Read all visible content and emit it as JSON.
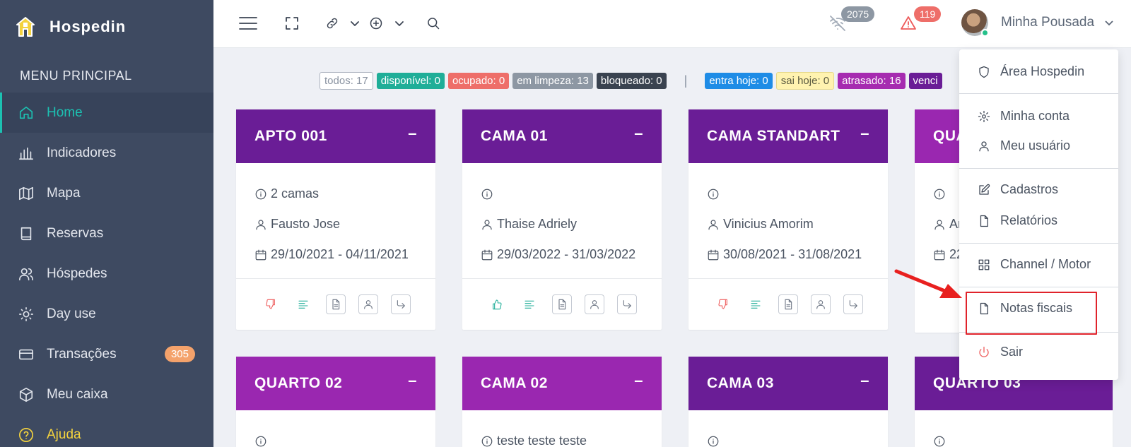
{
  "brand": {
    "name": "Hospedin"
  },
  "sidebar": {
    "title": "MENU PRINCIPAL",
    "items": [
      {
        "label": "Home",
        "icon": "home-icon",
        "active": true
      },
      {
        "label": "Indicadores",
        "icon": "bar-chart-icon"
      },
      {
        "label": "Mapa",
        "icon": "map-icon"
      },
      {
        "label": "Reservas",
        "icon": "book-icon"
      },
      {
        "label": "Hóspedes",
        "icon": "users-icon"
      },
      {
        "label": "Day use",
        "icon": "sun-icon"
      },
      {
        "label": "Transações",
        "icon": "credit-card-icon",
        "count": "305"
      },
      {
        "label": "Meu caixa",
        "icon": "box-icon"
      },
      {
        "label": "Ajuda",
        "icon": "help-circle-icon"
      }
    ]
  },
  "topbar": {
    "wifi_badge": "2075",
    "alert_badge": "119",
    "user_name": "Minha Pousada"
  },
  "status": {
    "todos": "todos: 17",
    "disponivel": "disponível: 0",
    "ocupado": "ocupado: 0",
    "limpeza": "em limpeza: 13",
    "bloqueado": "bloqueado: 0",
    "separator": "|",
    "entra_hoje": "entra hoje: 0",
    "sai_hoje": "sai hoje: 0",
    "atrasado": "atrasado: 16",
    "vencido": "venci"
  },
  "colors": {
    "sidebar": "#3e4a61",
    "accent": "#1cc1b2",
    "purple_dark": "#6a1d96",
    "purple_light": "#9a27b0",
    "disponivel": "#1fae98",
    "ocupado": "#ee6e69",
    "limpeza": "#8d97a3",
    "bloqueado": "#3a4350",
    "entra": "#1e8ce6",
    "sai": "#fff3b0",
    "atrasado": "#a62bb0"
  },
  "cards": [
    {
      "title": "APTO 001",
      "info": "2 camas",
      "guest": "Fausto Jose",
      "dates": "29/10/2021 - 04/11/2021",
      "thumb": "thumbs-down-icon"
    },
    {
      "title": "CAMA 01",
      "info": "",
      "guest": "Thaise Adriely",
      "dates": "29/03/2022 - 31/03/2022",
      "thumb": "thumbs-up-icon"
    },
    {
      "title": "CAMA STANDART",
      "info": "",
      "guest": "Vinicius Amorim",
      "dates": "30/08/2021 - 31/08/2021",
      "thumb": "thumbs-down-icon"
    },
    {
      "title": "QUA",
      "info": "",
      "guest": "An",
      "dates": "22"
    },
    {
      "title": "QUARTO 02",
      "info": ""
    },
    {
      "title": "CAMA 02",
      "info": "teste teste teste"
    },
    {
      "title": "CAMA 03",
      "info": ""
    },
    {
      "title": "QUARTO 03",
      "info": ""
    }
  ],
  "dropdown": {
    "area": "Área Hospedin",
    "conta": "Minha conta",
    "usuario": "Meu usuário",
    "cadastros": "Cadastros",
    "relatorios": "Relatórios",
    "channel": "Channel / Motor",
    "notas": "Notas fiscais",
    "sair": "Sair"
  }
}
